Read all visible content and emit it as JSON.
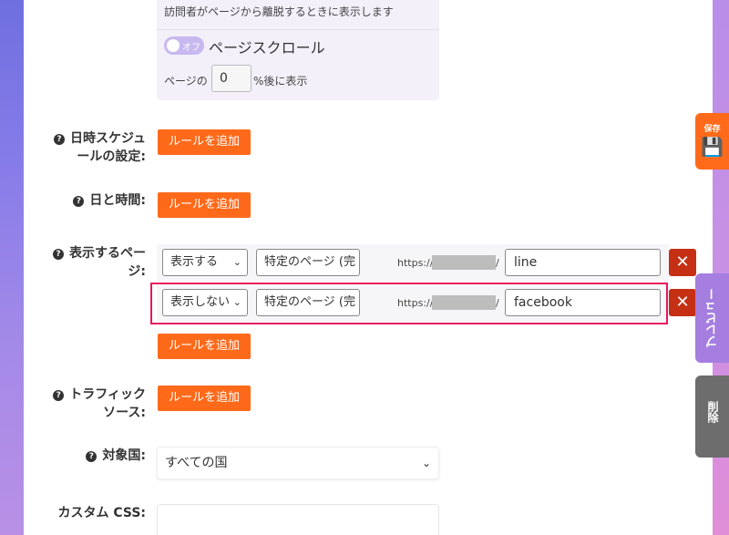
{
  "exit_section": {
    "description": "訪問者がページから離脱するときに表示します",
    "toggle_label": "オフ",
    "scroll_label": "ページスクロール",
    "percent_prefix": "ページの",
    "percent_value": "0",
    "percent_suffix": "%後に表示"
  },
  "schedule": {
    "label_line1": "日時スケジュ",
    "label_line2": "ールの設定:",
    "button": "ルールを追加"
  },
  "datetime": {
    "label": "日と時間:",
    "button": "ルールを追加"
  },
  "pages": {
    "label_line1": "表示するペー",
    "label_line2": "ジ:",
    "rules": [
      {
        "mode": "表示する",
        "type": "特定のページ (完",
        "url_prefix": "https://",
        "url_suffix": "/",
        "value": "line"
      },
      {
        "mode": "表示しない",
        "type": "特定のページ (完",
        "url_prefix": "https://",
        "url_suffix": "/",
        "value": "facebook"
      }
    ],
    "delete_symbol": "✕",
    "button": "ルールを追加"
  },
  "traffic": {
    "label_line1": "トラフィック",
    "label_line2": "ソース:",
    "button": "ルールを追加"
  },
  "country": {
    "label": "対象国:",
    "value": "すべての国"
  },
  "custom_css": {
    "label": "カスタム CSS:"
  },
  "side_tabs": {
    "save": "保存",
    "preview": "プレビュー",
    "delete": "削除"
  },
  "colors": {
    "accent_orange": "#ff6a1a",
    "delete_red": "#c53015",
    "highlight_pink": "#e8175d",
    "preview_purple": "#a57ee0"
  }
}
